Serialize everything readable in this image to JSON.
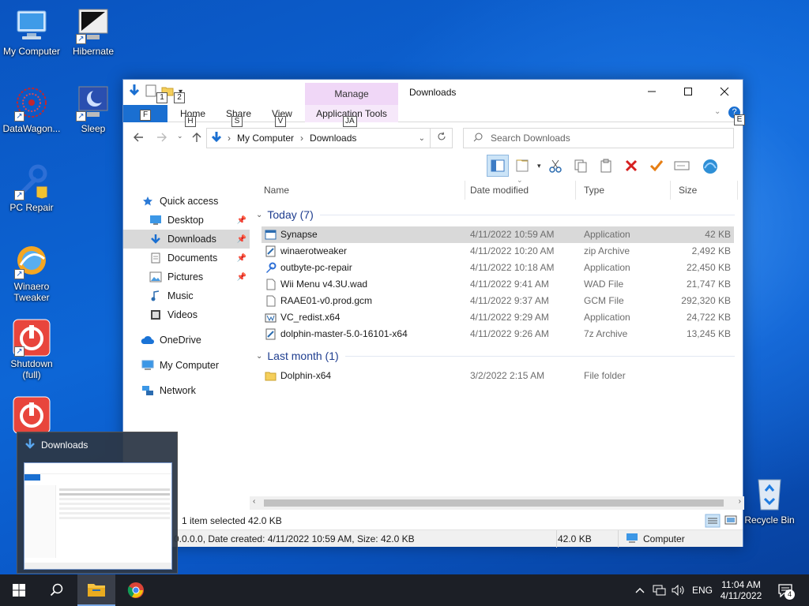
{
  "desktop": {
    "icons": [
      {
        "label": "My Computer"
      },
      {
        "label": "Hibernate"
      },
      {
        "label": "DataWagon..."
      },
      {
        "label": "Sleep"
      },
      {
        "label": "PC Repair"
      },
      {
        "label": "Winaero Tweaker"
      },
      {
        "label": "Shutdown (full)"
      },
      {
        "label": "Recycle Bin"
      }
    ]
  },
  "window": {
    "title": "Downloads",
    "manage_tab": "Manage",
    "qat_keytips": [
      "1",
      "2"
    ],
    "tabs": [
      {
        "label": "Home",
        "keytip": "H"
      },
      {
        "label": "Share",
        "keytip": "S"
      },
      {
        "label": "View",
        "keytip": "V"
      },
      {
        "label": "Application Tools",
        "keytip": "JA"
      }
    ],
    "file_keytip": "F",
    "help_keytip": "E",
    "address": {
      "crumbs": [
        "My Computer",
        "Downloads"
      ]
    },
    "search": {
      "placeholder": "Search Downloads"
    },
    "nav": [
      {
        "label": "Quick access"
      },
      {
        "label": "Desktop"
      },
      {
        "label": "Downloads"
      },
      {
        "label": "Documents"
      },
      {
        "label": "Pictures"
      },
      {
        "label": "Music"
      },
      {
        "label": "Videos"
      },
      {
        "label": "OneDrive"
      },
      {
        "label": "My Computer"
      },
      {
        "label": "Network"
      }
    ],
    "columns": [
      "Name",
      "Date modified",
      "Type",
      "Size"
    ],
    "groups": [
      {
        "title": "Today (7)",
        "files": [
          {
            "name": "Synapse",
            "date": "4/11/2022 10:59 AM",
            "type": "Application",
            "size": "42 KB",
            "icon": "app-window-icon",
            "selected": true
          },
          {
            "name": "winaerotweaker",
            "date": "4/11/2022 10:20 AM",
            "type": "zip Archive",
            "size": "2,492 KB",
            "icon": "zip-icon"
          },
          {
            "name": "outbyte-pc-repair",
            "date": "4/11/2022 10:18 AM",
            "type": "Application",
            "size": "22,450 KB",
            "icon": "installer-icon"
          },
          {
            "name": "Wii Menu v4.3U.wad",
            "date": "4/11/2022 9:41 AM",
            "type": "WAD File",
            "size": "21,747 KB",
            "icon": "blank-file-icon"
          },
          {
            "name": "RAAE01-v0.prod.gcm",
            "date": "4/11/2022 9:37 AM",
            "type": "GCM File",
            "size": "292,320 KB",
            "icon": "blank-file-icon"
          },
          {
            "name": "VC_redist.x64",
            "date": "4/11/2022 9:29 AM",
            "type": "Application",
            "size": "24,722 KB",
            "icon": "setup-icon"
          },
          {
            "name": "dolphin-master-5.0-16101-x64",
            "date": "4/11/2022 9:26 AM",
            "type": "7z Archive",
            "size": "13,245 KB",
            "icon": "zip-icon"
          }
        ]
      },
      {
        "title": "Last month (1)",
        "files": [
          {
            "name": "Dolphin-x64",
            "date": "3/2/2022 2:15 AM",
            "type": "File folder",
            "size": "",
            "icon": "folder-icon"
          }
        ]
      }
    ],
    "status": {
      "selection": "1 item selected  42.0 KB"
    },
    "details": {
      "text": "0.0.0.0, Date created: 4/11/2022 10:59 AM, Size: 42.0 KB",
      "size": "42.0 KB",
      "location": "Computer"
    }
  },
  "preview": {
    "title": "Downloads"
  },
  "tray": {
    "lang": "ENG",
    "time": "11:04 AM",
    "date": "4/11/2022",
    "notifications": "4"
  },
  "colors": {
    "accent": "#1a6fd1",
    "manage_tab": "#f0d7f7",
    "selection": "#d9d9d9",
    "group_header": "#1e3d8f"
  }
}
